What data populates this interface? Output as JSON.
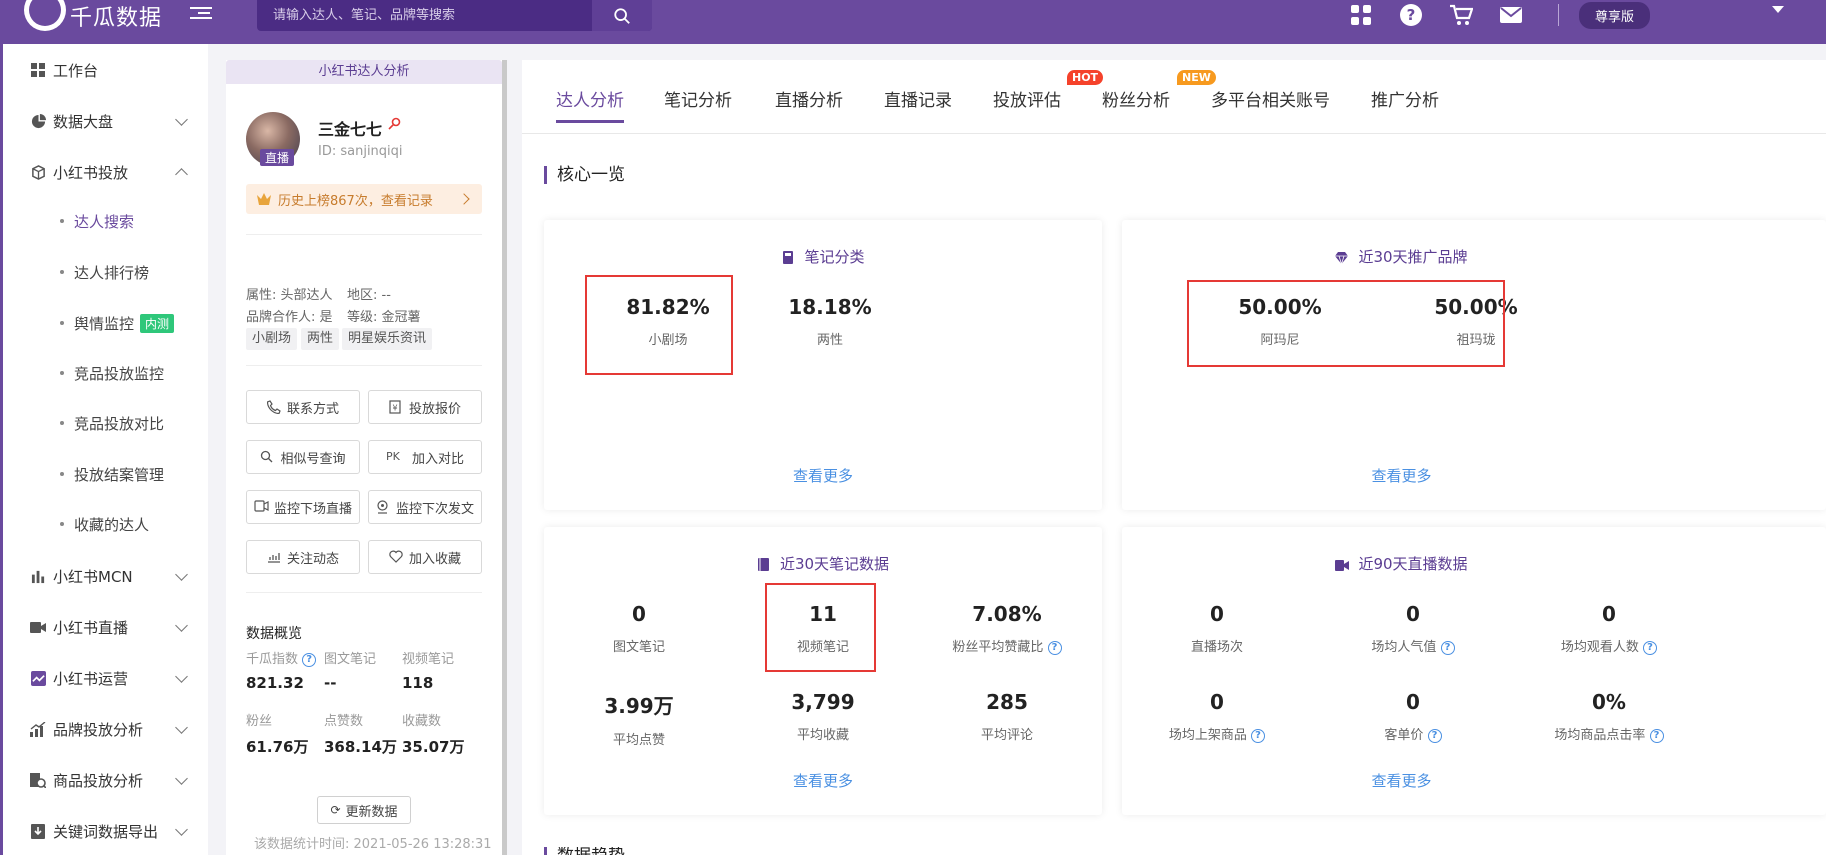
{
  "app": {
    "name": "千瓜数据"
  },
  "search": {
    "placeholder": "请输入达人、笔记、品牌等搜索"
  },
  "topbar": {
    "vip_label": "尊享版",
    "icons": [
      "apps-icon",
      "help-icon",
      "cart-icon",
      "mail-icon"
    ]
  },
  "sidebar": {
    "items": [
      {
        "label": "工作台",
        "icon": "dashboard-icon"
      },
      {
        "label": "数据大盘",
        "icon": "pie-chart-icon"
      },
      {
        "label": "小红书投放",
        "icon": "cube-icon"
      },
      {
        "label": "小红书MCN",
        "icon": "bar-chart-icon"
      },
      {
        "label": "小红书直播",
        "icon": "video-icon"
      },
      {
        "label": "小红书运营",
        "icon": "trend-icon"
      },
      {
        "label": "品牌投放分析",
        "icon": "growth-icon"
      },
      {
        "label": "商品投放分析",
        "icon": "product-icon"
      },
      {
        "label": "关键词数据导出",
        "icon": "export-icon"
      }
    ],
    "sub_items": [
      {
        "label": "达人搜索"
      },
      {
        "label": "达人排行榜"
      },
      {
        "label": "舆情监控",
        "tag": "内测"
      },
      {
        "label": "竞品投放监控"
      },
      {
        "label": "竞品投放对比"
      },
      {
        "label": "投放结案管理"
      },
      {
        "label": "收藏的达人"
      }
    ]
  },
  "profile": {
    "header": "小红书达人分析",
    "name": "三金七七",
    "id": "ID: sanjinqiqi",
    "live_badge": "直播",
    "rank_text": "历史上榜867次，查看记录",
    "attrs": {
      "type": "属性: 头部达人",
      "region": "地区: --",
      "brand_partner": "品牌合作人: 是",
      "level": "等级: 金冠薯"
    },
    "tags": [
      "小剧场",
      "两性",
      "明星娱乐资讯"
    ],
    "buttons": {
      "contact": "联系方式",
      "quote": "投放报价",
      "similar": "相似号查询",
      "compare": "加入对比",
      "monitor_live": "监控下场直播",
      "monitor_post": "监控下次发文",
      "follow": "关注动态",
      "favorite": "加入收藏"
    },
    "overview": {
      "title": "数据概览",
      "labels": [
        "千瓜指数",
        "图文笔记",
        "视频笔记",
        "粉丝",
        "点赞数",
        "收藏数"
      ],
      "values": [
        "821.32",
        "--",
        "118",
        "61.76万",
        "368.14万",
        "35.07万"
      ]
    },
    "refresh_label": "更新数据",
    "stat_time": "该数据统计时间: 2021-05-26 13:28:31"
  },
  "main": {
    "tabs": [
      {
        "label": "达人分析"
      },
      {
        "label": "笔记分析"
      },
      {
        "label": "直播分析"
      },
      {
        "label": "直播记录"
      },
      {
        "label": "投放评估",
        "badge": "HOT"
      },
      {
        "label": "粉丝分析",
        "badge": "NEW"
      },
      {
        "label": "多平台相关账号"
      },
      {
        "label": "推广分析"
      }
    ],
    "section_title": "核心一览",
    "more_label": "查看更多",
    "cards": {
      "note_category": {
        "title": "笔记分类",
        "metrics": [
          {
            "value": "81.82%",
            "label": "小剧场"
          },
          {
            "value": "18.18%",
            "label": "两性"
          }
        ]
      },
      "brands_30d": {
        "title": "近30天推广品牌",
        "metrics": [
          {
            "value": "50.00%",
            "label": "阿玛尼"
          },
          {
            "value": "50.00%",
            "label": "祖玛珑"
          }
        ]
      },
      "notes_30d": {
        "title": "近30天笔记数据",
        "metrics": [
          {
            "value": "0",
            "label": "图文笔记"
          },
          {
            "value": "11",
            "label": "视频笔记"
          },
          {
            "value": "7.08%",
            "label": "粉丝平均赞藏比"
          },
          {
            "value": "3.99万",
            "label": "平均点赞"
          },
          {
            "value": "3,799",
            "label": "平均收藏"
          },
          {
            "value": "285",
            "label": "平均评论"
          }
        ]
      },
      "live_90d": {
        "title": "近90天直播数据",
        "metrics": [
          {
            "value": "0",
            "label": "直播场次"
          },
          {
            "value": "0",
            "label": "场均人气值"
          },
          {
            "value": "0",
            "label": "场均观看人数"
          },
          {
            "value": "0",
            "label": "场均上架商品"
          },
          {
            "value": "0",
            "label": "客单价"
          },
          {
            "value": "0%",
            "label": "场均商品点击率"
          }
        ]
      }
    },
    "next_section_title": "数据趋势"
  },
  "colors": {
    "brand": "#6a4a9e",
    "link": "#4a90e2",
    "highlight": "#e53935",
    "hot": "#f5422b",
    "new": "#f79a1f",
    "beta": "#2ec77a"
  }
}
